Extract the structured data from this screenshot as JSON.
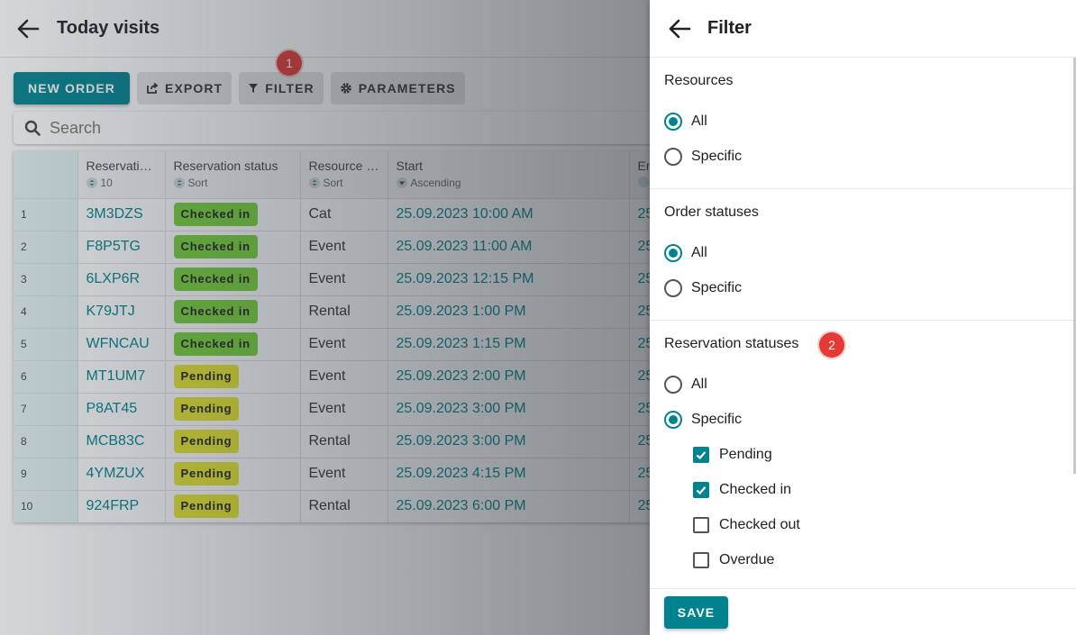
{
  "header": {
    "title": "Today visits"
  },
  "toolbar": {
    "new_order": "NEW ORDER",
    "export": "EXPORT",
    "filter": "FILTER",
    "parameters": "PARAMETERS"
  },
  "badges": {
    "one": "1",
    "two": "2"
  },
  "search": {
    "placeholder": "Search"
  },
  "table": {
    "columns": [
      {
        "label": "Reservatio…",
        "sort": "10"
      },
      {
        "label": "Reservation status",
        "sort": "Sort"
      },
      {
        "label": "Resource n…",
        "sort": "Sort"
      },
      {
        "label": "Start",
        "sort": "Ascending"
      },
      {
        "label": "En",
        "sort": ""
      }
    ],
    "rows": [
      {
        "n": "1",
        "code": "3M3DZS",
        "status": "Checked in",
        "resource": "Cat",
        "start": "25.09.2023 10:00 AM",
        "end": "25"
      },
      {
        "n": "2",
        "code": "F8P5TG",
        "status": "Checked in",
        "resource": "Event",
        "start": "25.09.2023 11:00 AM",
        "end": "25"
      },
      {
        "n": "3",
        "code": "6LXP6R",
        "status": "Checked in",
        "resource": "Event",
        "start": "25.09.2023 12:15 PM",
        "end": "25"
      },
      {
        "n": "4",
        "code": "K79JTJ",
        "status": "Checked in",
        "resource": "Rental",
        "start": "25.09.2023 1:00 PM",
        "end": "25"
      },
      {
        "n": "5",
        "code": "WFNCAU",
        "status": "Checked in",
        "resource": "Event",
        "start": "25.09.2023 1:15 PM",
        "end": "25"
      },
      {
        "n": "6",
        "code": "MT1UM7",
        "status": "Pending",
        "resource": "Event",
        "start": "25.09.2023 2:00 PM",
        "end": "25"
      },
      {
        "n": "7",
        "code": "P8AT45",
        "status": "Pending",
        "resource": "Event",
        "start": "25.09.2023 3:00 PM",
        "end": "25"
      },
      {
        "n": "8",
        "code": "MCB83C",
        "status": "Pending",
        "resource": "Rental",
        "start": "25.09.2023 3:00 PM",
        "end": "25"
      },
      {
        "n": "9",
        "code": "4YMZUX",
        "status": "Pending",
        "resource": "Event",
        "start": "25.09.2023 4:15 PM",
        "end": "25"
      },
      {
        "n": "10",
        "code": "924FRP",
        "status": "Pending",
        "resource": "Rental",
        "start": "25.09.2023 6:00 PM",
        "end": "25"
      }
    ]
  },
  "filter": {
    "title": "Filter",
    "resources": {
      "title": "Resources",
      "all": "All",
      "specific": "Specific"
    },
    "order_statuses": {
      "title": "Order statuses",
      "all": "All",
      "specific": "Specific"
    },
    "reservation_statuses": {
      "title": "Reservation statuses",
      "all": "All",
      "specific": "Specific",
      "options": [
        {
          "label": "Pending",
          "checked": true
        },
        {
          "label": "Checked in",
          "checked": true
        },
        {
          "label": "Checked out",
          "checked": false
        },
        {
          "label": "Overdue",
          "checked": false
        }
      ]
    },
    "save": "SAVE"
  },
  "colors": {
    "accent": "#00838f",
    "checked_in": "#76d13a",
    "pending": "#e6e62e",
    "badge": "#e53935"
  }
}
